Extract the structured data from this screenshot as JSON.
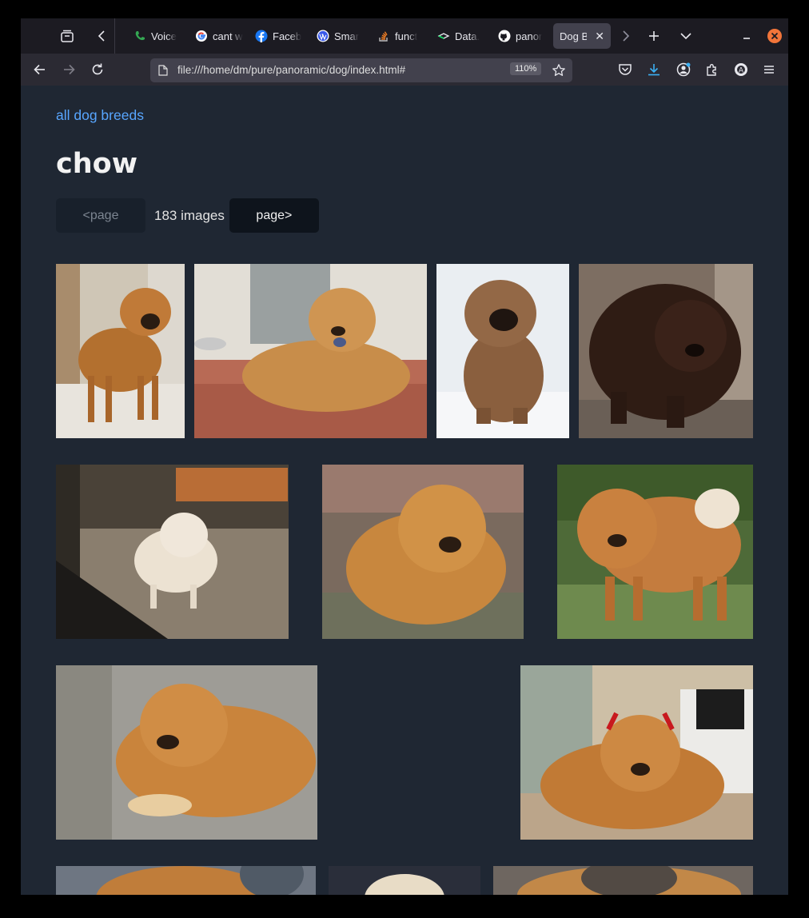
{
  "tabs": [
    {
      "title": "Voice",
      "icon": "voice-phone-icon"
    },
    {
      "title": "cant w",
      "icon": "google-icon"
    },
    {
      "title": "Faceb",
      "icon": "facebook-icon"
    },
    {
      "title": "Smar",
      "icon": "wordpress-icon"
    },
    {
      "title": "funct",
      "icon": "stackoverflow-icon"
    },
    {
      "title": "Data.",
      "icon": "datacamp-icon"
    },
    {
      "title": "panor",
      "icon": "github-icon"
    },
    {
      "title": "Dog Br",
      "icon": "none",
      "active": true
    }
  ],
  "address_bar": {
    "url": "file:///home/dm/pure/panoramic/dog/index.html#",
    "zoom": "110%"
  },
  "page": {
    "back_link": "all dog breeds",
    "title": "chow",
    "prev_label": "<page",
    "image_count": "183 images",
    "next_label": "page>"
  },
  "colors": {
    "page_bg": "#1f2733",
    "link": "#58a6ff",
    "tabstrip_bg": "#1c1b22",
    "navbar_bg": "#2b2a33",
    "close_button": "#f2753a"
  }
}
